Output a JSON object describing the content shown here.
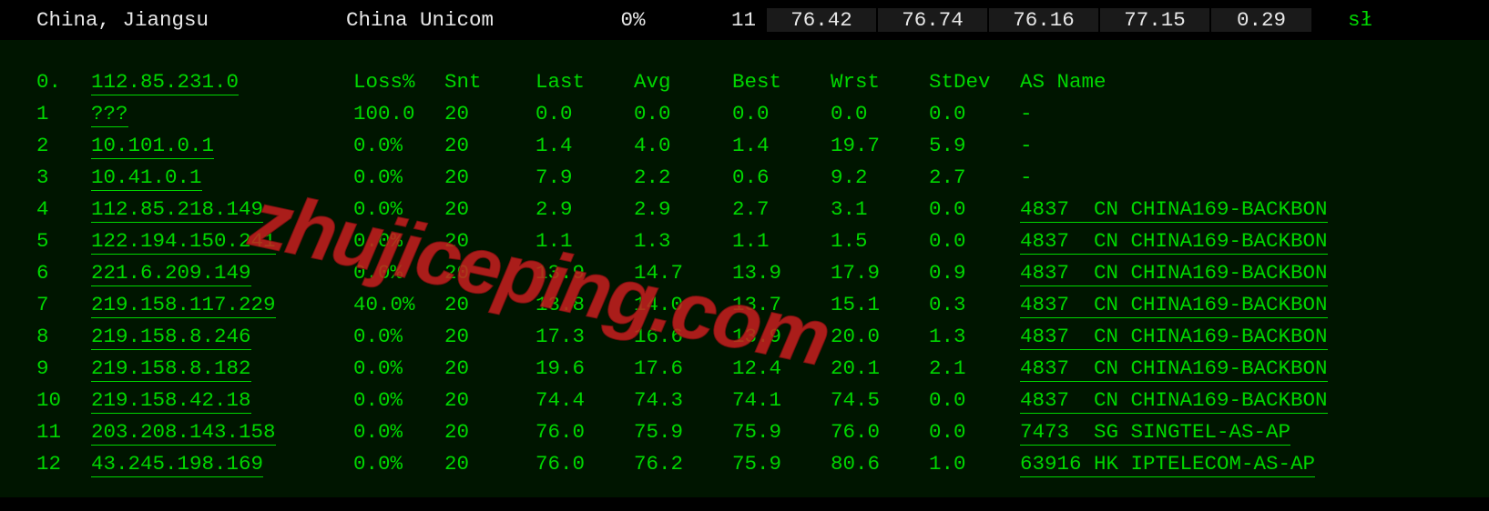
{
  "topbar": {
    "location": "China, Jiangsu",
    "isp": "China Unicom",
    "loss": "0%",
    "snt": "11",
    "last": "76.42",
    "avg": "76.74",
    "best": "76.16",
    "wrst": "77.15",
    "stdev": "0.29",
    "right": "sł"
  },
  "headers": {
    "hop": "0.",
    "ip": "112.85.231.0",
    "loss": "Loss%",
    "snt": "Snt",
    "last": "Last",
    "avg": "Avg",
    "best": "Best",
    "wrst": "Wrst",
    "stdev": "StDev",
    "as": "AS Name"
  },
  "hops": [
    {
      "n": "1",
      "ip": "???",
      "loss": "100.0",
      "snt": "20",
      "last": "0.0",
      "avg": "0.0",
      "best": "0.0",
      "wrst": "0.0",
      "stdev": "0.0",
      "as": "-"
    },
    {
      "n": "2",
      "ip": "10.101.0.1",
      "loss": "0.0%",
      "snt": "20",
      "last": "1.4",
      "avg": "4.0",
      "best": "1.4",
      "wrst": "19.7",
      "stdev": "5.9",
      "as": "-"
    },
    {
      "n": "3",
      "ip": "10.41.0.1",
      "loss": "0.0%",
      "snt": "20",
      "last": "7.9",
      "avg": "2.2",
      "best": "0.6",
      "wrst": "9.2",
      "stdev": "2.7",
      "as": "-"
    },
    {
      "n": "4",
      "ip": "112.85.218.149",
      "loss": "0.0%",
      "snt": "20",
      "last": "2.9",
      "avg": "2.9",
      "best": "2.7",
      "wrst": "3.1",
      "stdev": "0.0",
      "as": "4837  CN CHINA169-BACKBON"
    },
    {
      "n": "5",
      "ip": "122.194.150.241",
      "loss": "0.0%",
      "snt": "20",
      "last": "1.1",
      "avg": "1.3",
      "best": "1.1",
      "wrst": "1.5",
      "stdev": "0.0",
      "as": "4837  CN CHINA169-BACKBON"
    },
    {
      "n": "6",
      "ip": "221.6.209.149",
      "loss": "0.0%",
      "snt": "20",
      "last": "13.9",
      "avg": "14.7",
      "best": "13.9",
      "wrst": "17.9",
      "stdev": "0.9",
      "as": "4837  CN CHINA169-BACKBON"
    },
    {
      "n": "7",
      "ip": "219.158.117.229",
      "loss": "40.0%",
      "snt": "20",
      "last": "13.8",
      "avg": "14.0",
      "best": "13.7",
      "wrst": "15.1",
      "stdev": "0.3",
      "as": "4837  CN CHINA169-BACKBON"
    },
    {
      "n": "8",
      "ip": "219.158.8.246",
      "loss": "0.0%",
      "snt": "20",
      "last": "17.3",
      "avg": "16.6",
      "best": "13.9",
      "wrst": "20.0",
      "stdev": "1.3",
      "as": "4837  CN CHINA169-BACKBON"
    },
    {
      "n": "9",
      "ip": "219.158.8.182",
      "loss": "0.0%",
      "snt": "20",
      "last": "19.6",
      "avg": "17.6",
      "best": "12.4",
      "wrst": "20.1",
      "stdev": "2.1",
      "as": "4837  CN CHINA169-BACKBON"
    },
    {
      "n": "10",
      "ip": "219.158.42.18",
      "loss": "0.0%",
      "snt": "20",
      "last": "74.4",
      "avg": "74.3",
      "best": "74.1",
      "wrst": "74.5",
      "stdev": "0.0",
      "as": "4837  CN CHINA169-BACKBON"
    },
    {
      "n": "11",
      "ip": "203.208.143.158",
      "loss": "0.0%",
      "snt": "20",
      "last": "76.0",
      "avg": "75.9",
      "best": "75.9",
      "wrst": "76.0",
      "stdev": "0.0",
      "as": "7473  SG SINGTEL-AS-AP"
    },
    {
      "n": "12",
      "ip": "43.245.198.169",
      "loss": "0.0%",
      "snt": "20",
      "last": "76.0",
      "avg": "76.2",
      "best": "75.9",
      "wrst": "80.6",
      "stdev": "1.0",
      "as": "63916 HK IPTELECOM-AS-AP"
    }
  ],
  "watermark": "zhujiceping.com"
}
